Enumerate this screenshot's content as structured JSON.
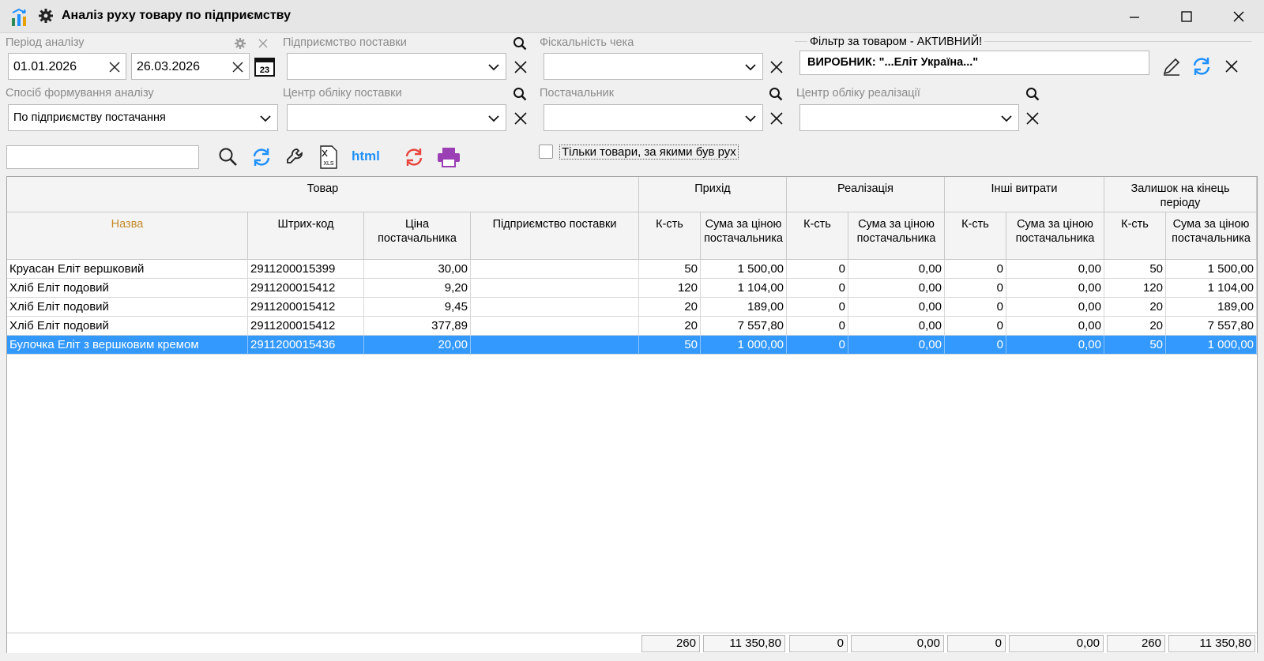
{
  "window": {
    "title": "Аналіз руху товару по підприємству"
  },
  "filters": {
    "period_label": "Період аналізу",
    "date_from": "01.01.2026",
    "date_to": "26.03.2026",
    "supplier_enterprise_label": "Підприємство поставки",
    "fiscal_label": "Фіскальність чека",
    "product_filter_label": "Фільтр за товаром - АКТИВНИЙ!",
    "product_filter_value": "ВИРОБНИК: \"...Еліт Україна...\"",
    "method_label": "Спосіб формування аналізу",
    "method_value": "По підприємству постачання",
    "supply_center_label": "Центр обліку поставки",
    "supplier_label": "Постачальник",
    "sales_center_label": "Центр обліку реалізації",
    "only_moved_label": "Тільки товари, за якими був рух"
  },
  "toolbar": {
    "html_label": "html"
  },
  "grid": {
    "group_headers": {
      "product": "Товар",
      "income": "Прихід",
      "sales": "Реалізація",
      "other": "Інші витрати",
      "balance": "Залишок на кінець періоду"
    },
    "columns": {
      "name": "Назва",
      "barcode": "Штрих-код",
      "price": "Ціна постачальника",
      "enterprise": "Підприємство поставки",
      "qty": "К-сть",
      "sum_income": "Сума за ціною постачальника",
      "sum": "Сума за ціною постачальника"
    },
    "rows": [
      {
        "name": "Круасан Еліт вершковий",
        "barcode": "2911200015399",
        "price": "30,00",
        "enterprise": "",
        "in_qty": "50",
        "in_sum": "1 500,00",
        "s_qty": "0",
        "s_sum": "0,00",
        "o_qty": "0",
        "o_sum": "0,00",
        "b_qty": "50",
        "b_sum": "1 500,00"
      },
      {
        "name": "Хліб Еліт подовий",
        "barcode": "2911200015412",
        "price": "9,20",
        "enterprise": "",
        "in_qty": "120",
        "in_sum": "1 104,00",
        "s_qty": "0",
        "s_sum": "0,00",
        "o_qty": "0",
        "o_sum": "0,00",
        "b_qty": "120",
        "b_sum": "1 104,00"
      },
      {
        "name": "Хліб Еліт подовий",
        "barcode": "2911200015412",
        "price": "9,45",
        "enterprise": "",
        "in_qty": "20",
        "in_sum": "189,00",
        "s_qty": "0",
        "s_sum": "0,00",
        "o_qty": "0",
        "o_sum": "0,00",
        "b_qty": "20",
        "b_sum": "189,00"
      },
      {
        "name": "Хліб Еліт подовий",
        "barcode": "2911200015412",
        "price": "377,89",
        "enterprise": "",
        "in_qty": "20",
        "in_sum": "7 557,80",
        "s_qty": "0",
        "s_sum": "0,00",
        "o_qty": "0",
        "o_sum": "0,00",
        "b_qty": "20",
        "b_sum": "7 557,80"
      },
      {
        "name": "Булочка Еліт з вершковим кремом",
        "barcode": "2911200015436",
        "price": "20,00",
        "enterprise": "",
        "in_qty": "50",
        "in_sum": "1 000,00",
        "s_qty": "0",
        "s_sum": "0,00",
        "o_qty": "0",
        "o_sum": "0,00",
        "b_qty": "50",
        "b_sum": "1 000,00"
      }
    ],
    "totals": {
      "in_qty": "260",
      "in_sum": "11 350,80",
      "s_qty": "0",
      "s_sum": "0,00",
      "o_qty": "0",
      "o_sum": "0,00",
      "b_qty": "260",
      "b_sum": "11 350,80"
    }
  },
  "colors": {
    "selection": "#3399ff",
    "accent_blue": "#1e90ff",
    "print_purple": "#9b3fb5",
    "refresh_red": "#e8453c",
    "name_header": "#c58a2a"
  }
}
